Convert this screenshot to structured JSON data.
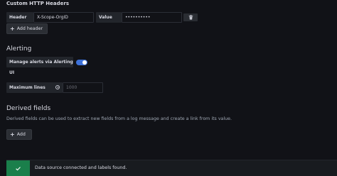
{
  "custom_headers": {
    "title": "Custom HTTP Headers",
    "header_label": "Header",
    "header_value": "X-Scope-OrgID",
    "value_label": "Value",
    "value_masked": "••••••••••",
    "add_header_label": "Add header"
  },
  "alerting": {
    "title": "Alerting",
    "manage_alerts_label": "Manage alerts via Alerting UI",
    "manage_alerts_enabled": true,
    "max_lines_label": "Maximum lines",
    "max_lines_placeholder": "1000"
  },
  "derived_fields": {
    "title": "Derived fields",
    "description": "Derived fields can be used to extract new fields from a log message and create a link from its value.",
    "add_label": "Add"
  },
  "status": {
    "message": "Data source connected and labels found."
  },
  "icons": {
    "delete": "trash-icon",
    "add": "plus-icon",
    "info": "info-icon",
    "success": "check-icon"
  },
  "colors": {
    "toggle_on": "#3d71d9",
    "success": "#1a7f4b"
  }
}
